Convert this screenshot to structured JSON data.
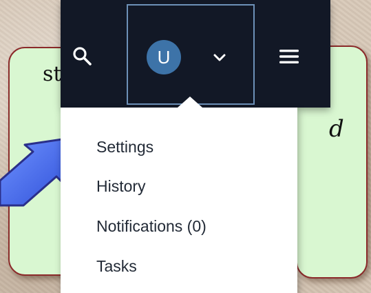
{
  "slide": {
    "left_fragment": "st",
    "right_fragment": "d"
  },
  "navbar": {
    "search_icon": "search-icon",
    "avatar_initial": "U",
    "chevron_icon": "chevron-down-icon",
    "menu_icon": "hamburger-menu-icon"
  },
  "dropdown": {
    "items": [
      "Settings",
      "History",
      "Notifications (0)",
      "Tasks"
    ]
  },
  "colors": {
    "navbar_bg": "#121826",
    "avatar_bg": "#3d73a8",
    "highlight_border": "#6d91b8",
    "arrow_fill": "#3b63e6",
    "box_fill": "#d9f7d1",
    "box_border": "#8b2a2a"
  }
}
